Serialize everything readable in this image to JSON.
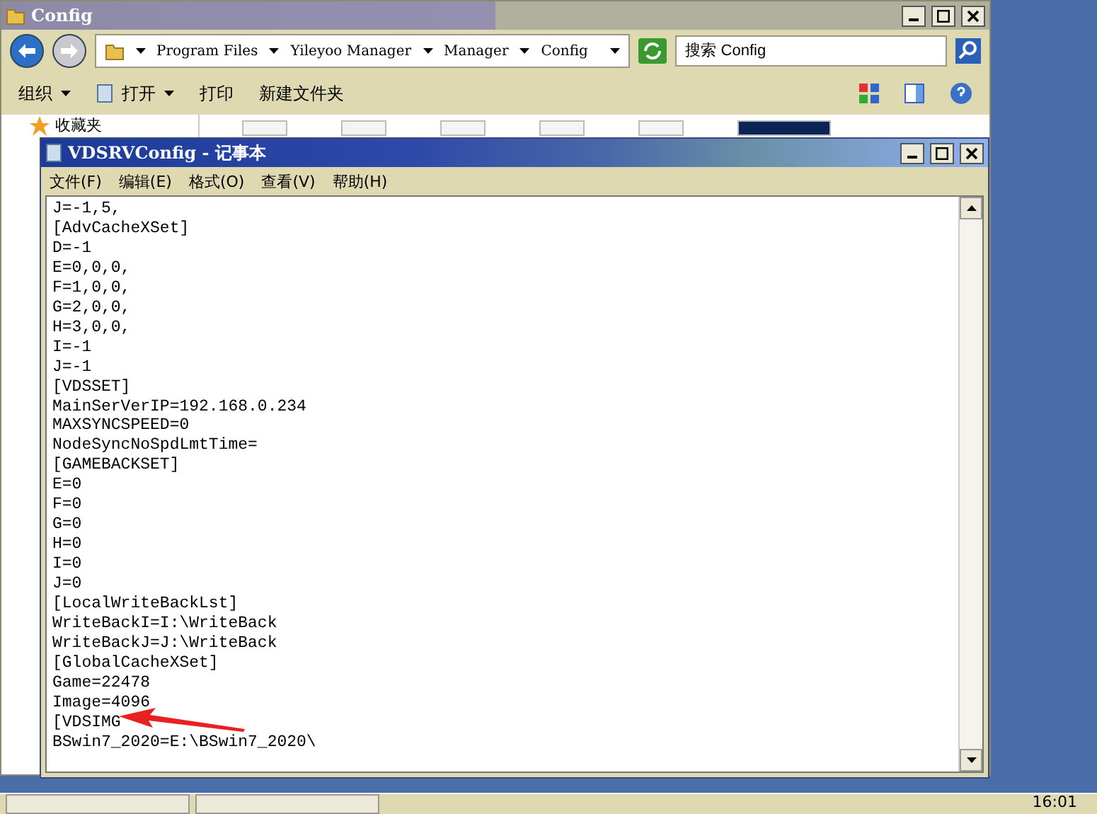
{
  "explorer": {
    "title": "Config",
    "breadcrumbs": [
      "Program Files",
      "Yileyoo Manager",
      "Manager",
      "Config"
    ],
    "search": {
      "placeholder": "搜索 Config"
    },
    "toolbar": [
      {
        "label": "组织",
        "dropdown": true,
        "kind": "text"
      },
      {
        "label": "打开",
        "dropdown": true,
        "kind": "icon"
      },
      {
        "label": "打印",
        "dropdown": false,
        "kind": "text"
      },
      {
        "label": "新建文件夹",
        "dropdown": false,
        "kind": "text"
      }
    ],
    "sidebar": {
      "items": [
        {
          "label": "收藏夹",
          "selected": false
        }
      ]
    },
    "files": [
      {
        "selected": false
      },
      {
        "selected": false
      },
      {
        "selected": false
      },
      {
        "selected": false
      },
      {
        "selected": false
      },
      {
        "selected": true
      }
    ]
  },
  "notepad": {
    "title": "VDSRVConfig - 记事本",
    "menu": [
      "文件(F)",
      "编辑(E)",
      "格式(O)",
      "查看(V)",
      "帮助(H)"
    ],
    "lines": [
      "J=-1,5,",
      "[AdvCacheXSet]",
      "D=-1",
      "E=0,0,0,",
      "F=1,0,0,",
      "G=2,0,0,",
      "H=3,0,0,",
      "I=-1",
      "J=-1",
      "[VDSSET]",
      "MainSerVerIP=192.168.0.234",
      "MAXSYNCSPEED=0",
      "NodeSyncNoSpdLmtTime=",
      "[GAMEBACKSET]",
      "E=0",
      "F=0",
      "G=0",
      "H=0",
      "I=0",
      "J=0",
      "[LocalWriteBackLst]",
      "WriteBackI=I:\\WriteBack",
      "WriteBackJ=J:\\WriteBack",
      "[GlobalCacheXSet]",
      "Game=22478",
      "Image=4096",
      "[VDSIMG",
      "BSwin7_2020=E:\\BSwin7_2020\\"
    ]
  },
  "taskbar": {
    "clock": "16:01"
  }
}
